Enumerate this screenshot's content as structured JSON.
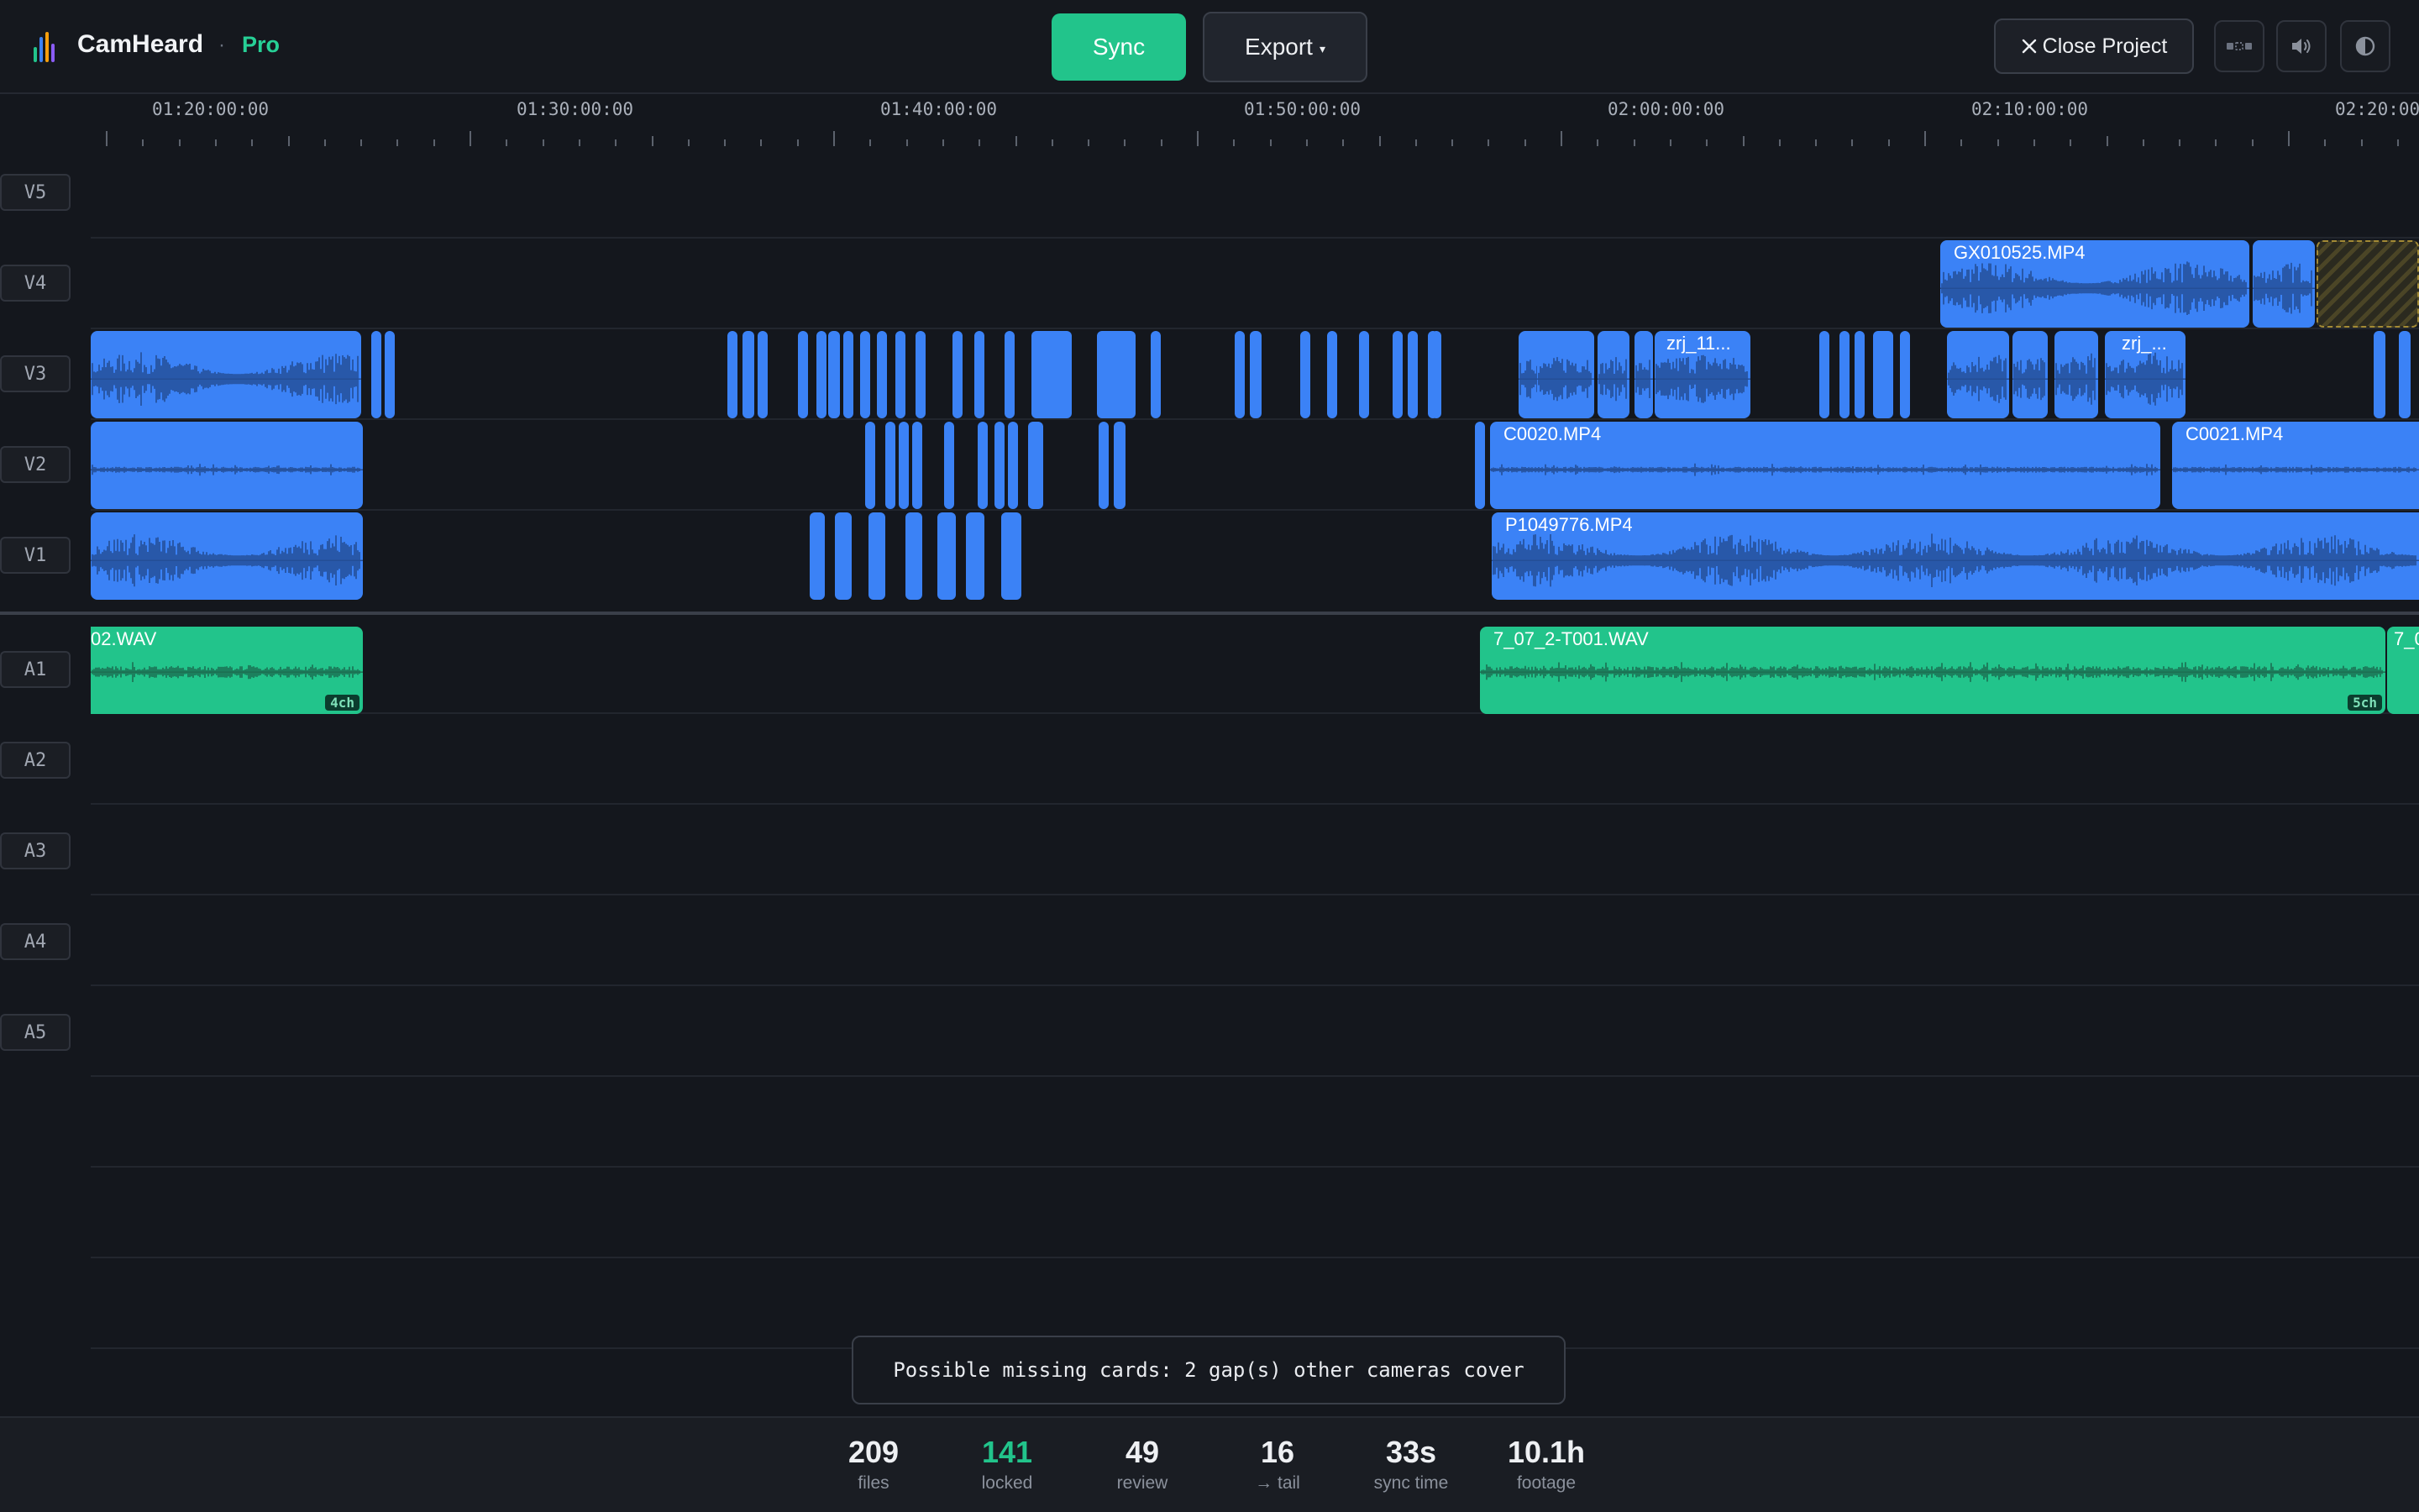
{
  "app": {
    "name": "CamHeard",
    "separator": "·",
    "tier": "Pro",
    "brand_color": "#22c48b",
    "video_color": "#3b82f6"
  },
  "toolbar": {
    "sync_label": "Sync",
    "export_label": "Export",
    "export_caret": "▾",
    "close_label": "Close Project",
    "close_icon": "close-icon"
  },
  "toolbar_icons": [
    "layout-icon",
    "volume-icon",
    "contrast-icon"
  ],
  "ruler": {
    "labels": [
      "01:20:00:00",
      "01:30:00:00",
      "01:40:00:00",
      "01:50:00:00",
      "02:00:00:00",
      "02:10:00:00",
      "02:20:00:00"
    ]
  },
  "tracks": {
    "video": [
      "V5",
      "V4",
      "V3",
      "V2",
      "V1"
    ],
    "audio": [
      "A1",
      "A2",
      "A3",
      "A4",
      "A5"
    ]
  },
  "clips": {
    "v4_a": "GX010525.MP4",
    "v3_a": "zrj_11...",
    "v3_b": "zrj_...",
    "v2_a": "C0020.MP4",
    "v2_b": "C0021.MP4",
    "v1_a": "P1049776.MP4",
    "a1_a": "02.WAV",
    "a1_a_channels": "4ch",
    "a1_b": "7_07_2-T001.WAV",
    "a1_b_channels": "5ch",
    "a1_c": "7_0"
  },
  "toast": "Possible missing cards: 2 gap(s) other cameras cover",
  "stats": [
    {
      "value": "209",
      "label": "files"
    },
    {
      "value": "141",
      "label": "locked",
      "color": "#22c48b"
    },
    {
      "value": "49",
      "label": "review"
    },
    {
      "value": "16",
      "label": "→ tail"
    },
    {
      "value": "33s",
      "label": "sync time"
    },
    {
      "value": "10.1h",
      "label": "footage"
    }
  ]
}
